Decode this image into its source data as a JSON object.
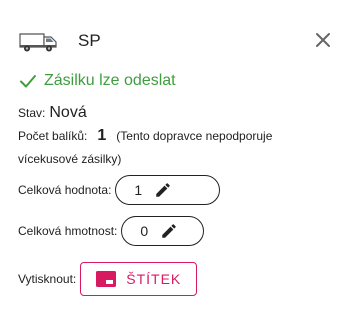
{
  "header": {
    "carrier": "SP"
  },
  "status": {
    "text": "Zásilku lze odeslat"
  },
  "state": {
    "label": "Stav:",
    "value": "Nová"
  },
  "packages": {
    "label": "Počet balíků:",
    "count": "1",
    "note_line1": "(Tento dopravce nepodporuje",
    "note_line2": "vícekusové zásilky)"
  },
  "total_value": {
    "label": "Celková hodnota:",
    "value": "1"
  },
  "total_weight": {
    "label": "Celková hmotnost:",
    "value": "0"
  },
  "print": {
    "label": "Vytisknout:",
    "button_label": "ŠTÍTEK"
  },
  "colors": {
    "success": "#3f9d3f",
    "accent": "#d81b60"
  },
  "icons": [
    "van-icon",
    "close-icon",
    "check-icon",
    "pencil-icon",
    "label-icon"
  ]
}
